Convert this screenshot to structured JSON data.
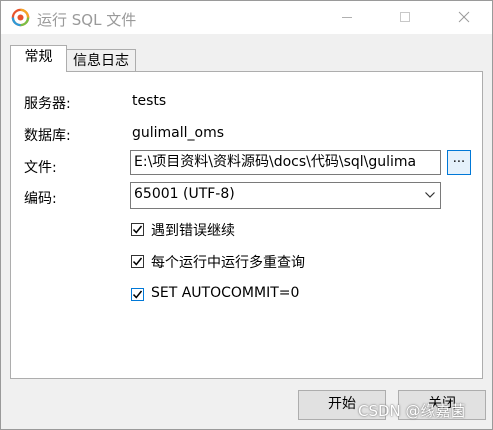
{
  "window": {
    "title": "运行 SQL 文件"
  },
  "tabs": [
    {
      "label": "常规",
      "active": true
    },
    {
      "label": "信息日志",
      "active": false
    }
  ],
  "form": {
    "server_label": "服务器:",
    "server_value": "tests",
    "database_label": "数据库:",
    "database_value": "gulimall_oms",
    "file_label": "文件:",
    "file_value": "E:\\项目资料\\资料源码\\docs\\代码\\sql\\gulima",
    "browse_label": "...",
    "encoding_label": "编码:",
    "encoding_value": "65001 (UTF-8)"
  },
  "options": [
    {
      "label": "遇到错误继续",
      "checked": true
    },
    {
      "label": "每个运行中运行多重查询",
      "checked": true
    },
    {
      "label": "SET AUTOCOMMIT=0",
      "checked": true
    }
  ],
  "buttons": {
    "start_label": "开始",
    "close_label": "关闭"
  },
  "watermark": "CSDN @缘嘉菌",
  "colors": {
    "accent": "#0078d7",
    "panel_bg": "#ffffff",
    "window_bg": "#f0f0f0",
    "title_text": "#9a9a9a"
  },
  "icons": {
    "app": "navicat-app-icon",
    "minimize": "minimize-icon",
    "maximize": "maximize-icon",
    "close": "close-icon",
    "dropdown": "chevron-down-icon",
    "check": "checkmark-icon"
  }
}
